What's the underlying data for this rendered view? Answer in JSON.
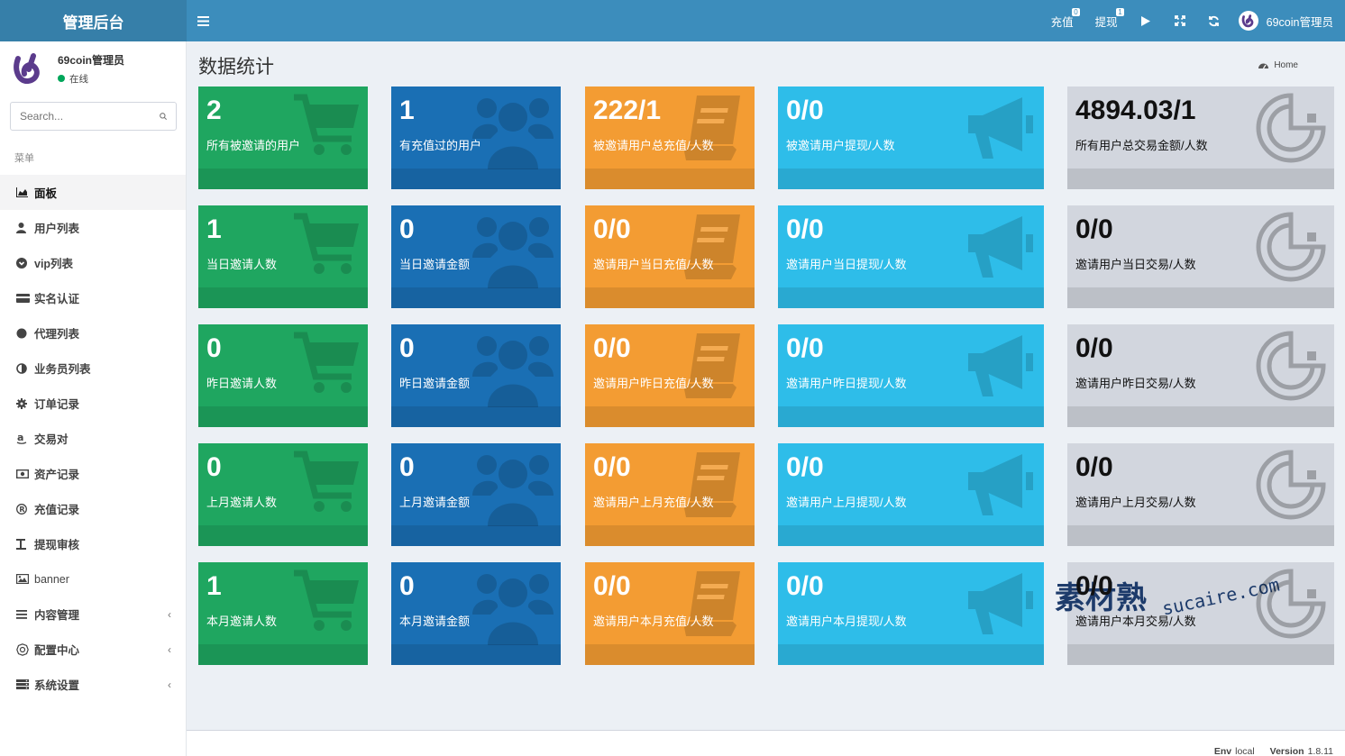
{
  "app": {
    "brand": "管理后台"
  },
  "topbar": {
    "recharge": {
      "label": "充值",
      "badge": "0"
    },
    "withdraw": {
      "label": "提现",
      "badge": "1"
    },
    "user_name": "69coin管理员"
  },
  "sidebar": {
    "user": {
      "name": "69coin管理员",
      "status": "在线"
    },
    "search_placeholder": "Search...",
    "menu_header": "菜单",
    "items": [
      {
        "label": "面板",
        "icon": "area-chart-icon",
        "active": true
      },
      {
        "label": "用户列表",
        "icon": "user-icon"
      },
      {
        "label": "vip列表",
        "icon": "chevron-circle-icon"
      },
      {
        "label": "实名认证",
        "icon": "id-card-icon"
      },
      {
        "label": "代理列表",
        "icon": "circle-icon"
      },
      {
        "label": "业务员列表",
        "icon": "half-circle-icon"
      },
      {
        "label": "订单记录",
        "icon": "gear-icon"
      },
      {
        "label": "交易对",
        "icon": "amazon-icon"
      },
      {
        "label": "资产记录",
        "icon": "money-icon"
      },
      {
        "label": "充值记录",
        "icon": "registered-icon"
      },
      {
        "label": "提现审核",
        "icon": "text-height-icon"
      },
      {
        "label": "banner",
        "icon": "image-icon"
      },
      {
        "label": "内容管理",
        "icon": "bars-icon",
        "caret": "‹"
      },
      {
        "label": "配置中心",
        "icon": "cog-icon",
        "caret": "‹"
      },
      {
        "label": "系统设置",
        "icon": "server-icon",
        "caret": "‹"
      }
    ]
  },
  "page": {
    "title": "数据统计",
    "breadcrumb": "Home"
  },
  "stats": [
    [
      {
        "value": "2",
        "label": "所有被邀请的用户",
        "color": "#1fa660",
        "icon": "shopping-cart-icon"
      },
      {
        "value": "1",
        "label": "有充值过的用户",
        "color": "#1a6fb4",
        "icon": "users-icon"
      },
      {
        "value": "222/1",
        "label": "被邀请用户总充值/人数",
        "color": "#f39c33",
        "icon": "book-icon"
      },
      {
        "value": "0/0",
        "label": "被邀请用户提现/人数",
        "color": "#2ebde9",
        "icon": "bullhorn-icon"
      },
      {
        "value": "4894.03/1",
        "label": "所有用户总交易金额/人数",
        "color": "#d2d6de",
        "icon": "pacman-icon"
      }
    ],
    [
      {
        "value": "1",
        "label": "当日邀请人数"
      },
      {
        "value": "0",
        "label": "当日邀请金额"
      },
      {
        "value": "0/0",
        "label": "邀请用户当日充值/人数"
      },
      {
        "value": "0/0",
        "label": "邀请用户当日提现/人数"
      },
      {
        "value": "0/0",
        "label": "邀请用户当日交易/人数"
      }
    ],
    [
      {
        "value": "0",
        "label": "昨日邀请人数"
      },
      {
        "value": "0",
        "label": "昨日邀请金额"
      },
      {
        "value": "0/0",
        "label": "邀请用户昨日充值/人数"
      },
      {
        "value": "0/0",
        "label": "邀请用户昨日提现/人数"
      },
      {
        "value": "0/0",
        "label": "邀请用户昨日交易/人数"
      }
    ],
    [
      {
        "value": "0",
        "label": "上月邀请人数"
      },
      {
        "value": "0",
        "label": "上月邀请金额"
      },
      {
        "value": "0/0",
        "label": "邀请用户上月充值/人数"
      },
      {
        "value": "0/0",
        "label": "邀请用户上月提现/人数"
      },
      {
        "value": "0/0",
        "label": "邀请用户上月交易/人数"
      }
    ],
    [
      {
        "value": "1",
        "label": "本月邀请人数"
      },
      {
        "value": "0",
        "label": "本月邀请金额"
      },
      {
        "value": "0/0",
        "label": "邀请用户本月充值/人数"
      },
      {
        "value": "0/0",
        "label": "邀请用户本月提现/人数"
      },
      {
        "value": "0/0",
        "label": "邀请用户本月交易/人数"
      }
    ]
  ],
  "footer": {
    "env_label": "Env",
    "env_value": "local",
    "version_label": "Version",
    "version_value": "1.8.11"
  },
  "watermark": {
    "cn": "素材熟",
    "en": "sucaire.com"
  }
}
